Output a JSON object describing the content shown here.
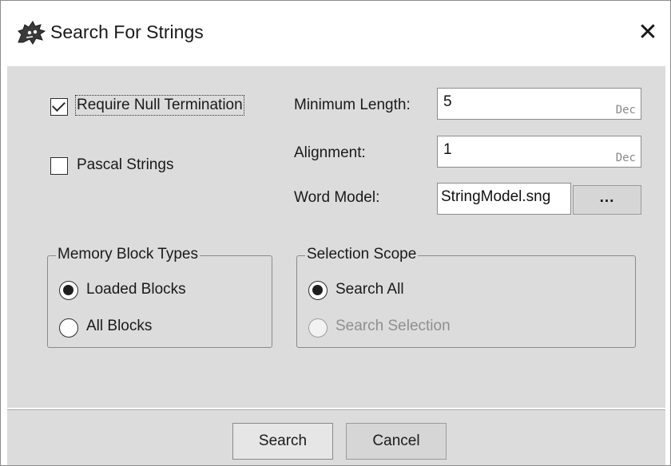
{
  "window": {
    "title": "Search For Strings",
    "icon": "dragon-icon",
    "close_glyph": "✕"
  },
  "options": {
    "require_null": {
      "label": "Require Null Termination",
      "checked": true
    },
    "pascal": {
      "label": "Pascal Strings",
      "checked": false
    }
  },
  "fields": {
    "min_length": {
      "label": "Minimum Length:",
      "value": "5",
      "suffix": "Dec"
    },
    "alignment": {
      "label": "Alignment:",
      "value": "1",
      "suffix": "Dec"
    },
    "word_model": {
      "label": "Word Model:",
      "value": "StringModel.sng",
      "browse_label": "..."
    }
  },
  "memory_block_types": {
    "title": "Memory Block Types",
    "options": [
      {
        "label": "Loaded Blocks",
        "selected": true,
        "enabled": true
      },
      {
        "label": "All Blocks",
        "selected": false,
        "enabled": true
      }
    ]
  },
  "selection_scope": {
    "title": "Selection Scope",
    "options": [
      {
        "label": "Search All",
        "selected": true,
        "enabled": true
      },
      {
        "label": "Search Selection",
        "selected": false,
        "enabled": false
      }
    ]
  },
  "buttons": {
    "search": "Search",
    "cancel": "Cancel"
  }
}
